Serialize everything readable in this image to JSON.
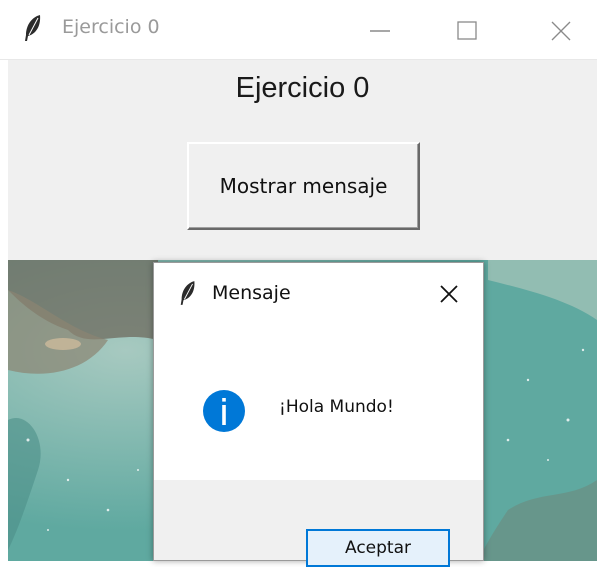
{
  "window": {
    "title": "Ejercicio 0",
    "icon": "feather-icon",
    "controls": [
      "minimize-icon",
      "maximize-icon",
      "close-icon"
    ]
  },
  "main": {
    "heading": "Ejercicio 0",
    "button_label": "Mostrar mensaje"
  },
  "dialog": {
    "title": "Mensaje",
    "icon": "info-icon",
    "message": "¡Hola Mundo!",
    "ok_label": "Aceptar"
  },
  "colors": {
    "info_blue": "#0078d7",
    "focus_border": "#0078d7",
    "surface": "#f0f0f0",
    "artwork_teal": "#7db9b0"
  }
}
